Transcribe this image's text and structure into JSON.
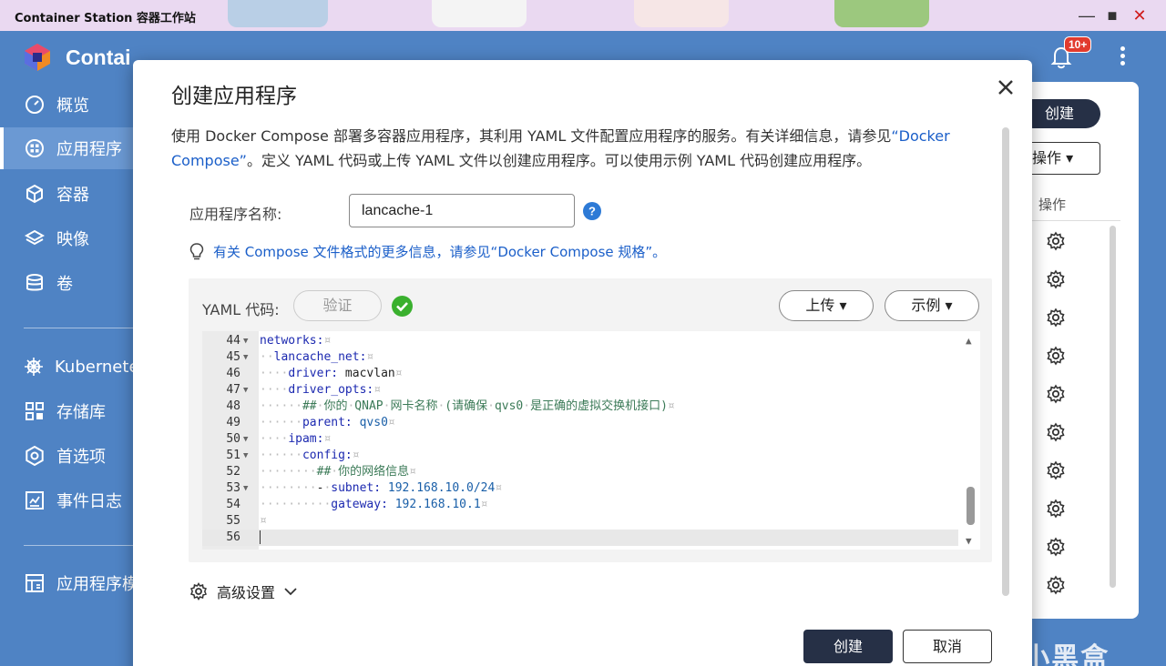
{
  "window": {
    "title": "Container Station 容器工作站"
  },
  "app": {
    "brand": "Contai",
    "notification_badge": "10+"
  },
  "sidebar": {
    "items": [
      {
        "label": "概览",
        "icon": "dashboard-icon"
      },
      {
        "label": "应用程序",
        "icon": "apps-icon",
        "active": true
      },
      {
        "label": "容器",
        "icon": "cube-icon"
      },
      {
        "label": "映像",
        "icon": "layers-icon"
      },
      {
        "label": "卷",
        "icon": "database-icon"
      },
      {
        "label": "Kubernetes",
        "icon": "helm-icon"
      },
      {
        "label": "存储库",
        "icon": "repository-icon"
      },
      {
        "label": "首选项",
        "icon": "settings-icon"
      },
      {
        "label": "事件日志",
        "icon": "log-icon"
      },
      {
        "label": "应用程序模",
        "icon": "template-icon"
      }
    ]
  },
  "right_panel": {
    "create_label": "创建",
    "ops_label": "操作",
    "ops_column_header": "操作",
    "watermark": "小黑盒"
  },
  "dialog": {
    "title": "创建应用程序",
    "description_part1": "使用 Docker Compose 部署多容器应用程序，其利用 YAML 文件配置应用程序的服务。有关详细信息，请参见",
    "description_link": "“Docker Compose”",
    "description_part2": "。定义 YAML 代码或上传 YAML 文件以创建应用程序。可以使用示例 YAML 代码创建应用程序。",
    "app_name_label": "应用程序名称:",
    "app_name_value": "lancache-1",
    "tip_text": "有关 Compose 文件格式的更多信息，请参见“Docker Compose 规格”。",
    "yaml_label": "YAML 代码:",
    "verify_label": "验证",
    "upload_label": "上传",
    "example_label": "示例",
    "advanced_label": "高级设置",
    "create_button": "创建",
    "cancel_button": "取消"
  },
  "editor": {
    "lines": [
      {
        "n": "44",
        "fold": true,
        "text": "networks:¤"
      },
      {
        "n": "45",
        "fold": true,
        "text": "··lancache_net:¤"
      },
      {
        "n": "46",
        "fold": false,
        "text": "····driver: macvlan¤"
      },
      {
        "n": "47",
        "fold": true,
        "text": "····driver_opts:¤"
      },
      {
        "n": "48",
        "fold": false,
        "text": "······##·你的·QNAP·网卡名称·(请确保·qvs0·是正确的虚拟交换机接口)¤"
      },
      {
        "n": "49",
        "fold": false,
        "text": "······parent: qvs0¤"
      },
      {
        "n": "50",
        "fold": true,
        "text": "····ipam:¤"
      },
      {
        "n": "51",
        "fold": true,
        "text": "······config:¤"
      },
      {
        "n": "52",
        "fold": false,
        "text": "········##·你的网络信息¤"
      },
      {
        "n": "53",
        "fold": true,
        "text": "········-·subnet: 192.168.10.0/24¤"
      },
      {
        "n": "54",
        "fold": false,
        "text": "··········gateway: 192.168.10.1¤"
      },
      {
        "n": "55",
        "fold": false,
        "text": "¤"
      },
      {
        "n": "56",
        "fold": false,
        "text": "",
        "current": true
      }
    ]
  }
}
